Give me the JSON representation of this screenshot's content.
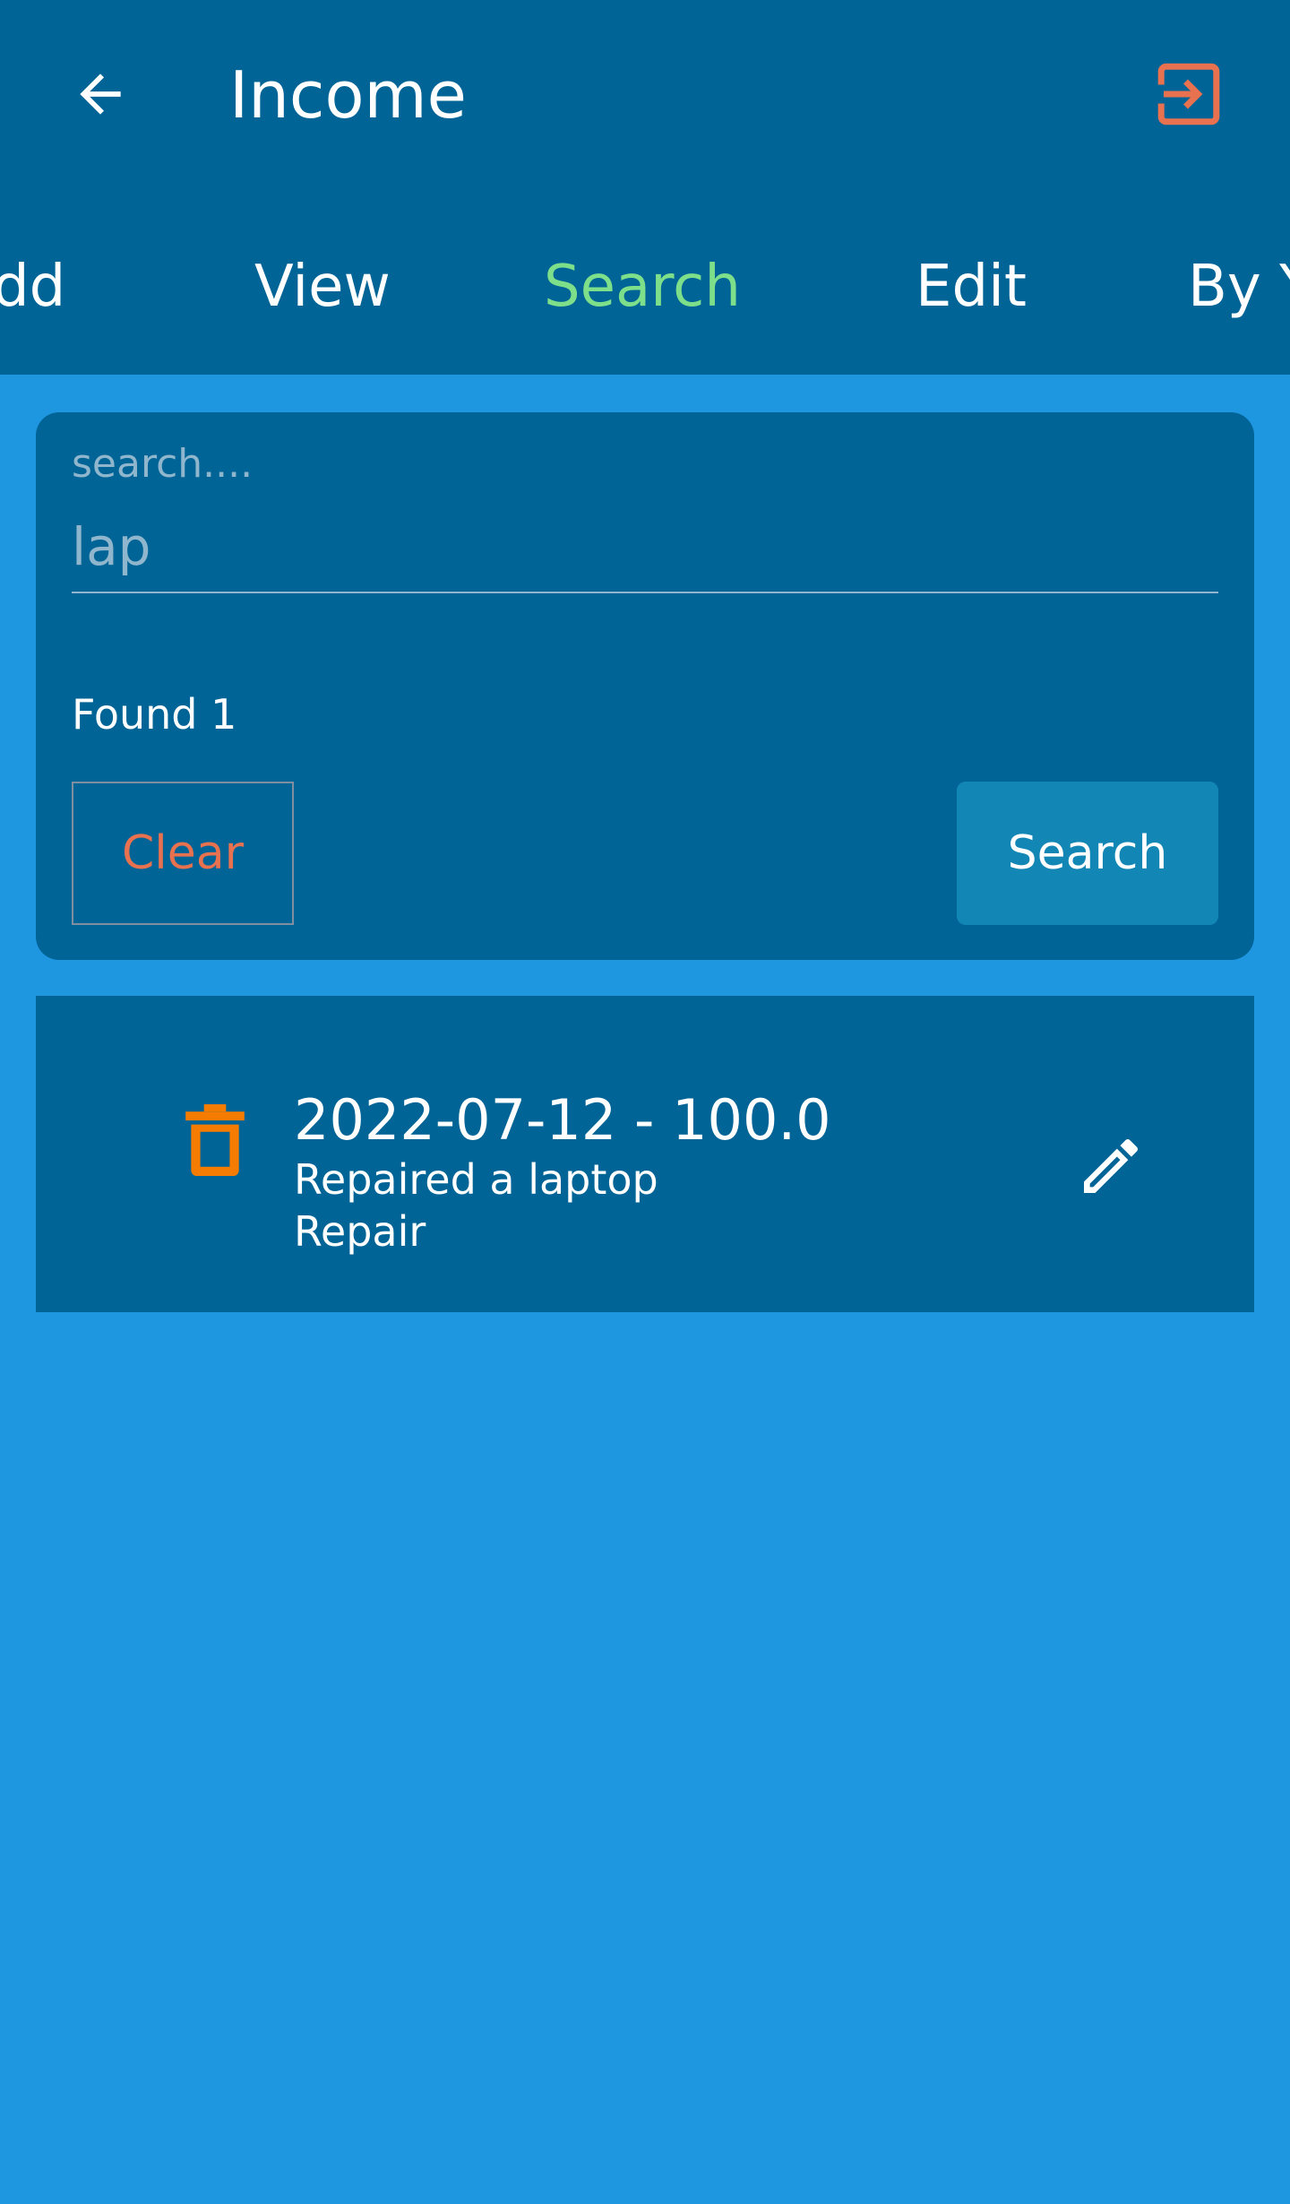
{
  "appbar": {
    "title": "Income",
    "back_icon": "arrow-left-icon",
    "logout_icon": "logout-icon"
  },
  "tabs": [
    {
      "label": "dd",
      "active": false
    },
    {
      "label": "View",
      "active": false
    },
    {
      "label": "Search",
      "active": true
    },
    {
      "label": "Edit",
      "active": false
    },
    {
      "label": "By Y",
      "active": false
    }
  ],
  "search": {
    "label": "search....",
    "value": "lap",
    "found_text": "Found 1",
    "clear_label": "Clear",
    "search_label": "Search"
  },
  "results": [
    {
      "title": "2022-07-12 - 100.0",
      "description": "Repaired a laptop",
      "category": "Repair",
      "delete_icon": "trash-icon",
      "edit_icon": "pencil-icon"
    }
  ],
  "colors": {
    "background": "#1e96e0",
    "appbar": "#006496",
    "active_tab": "#7ddf8a",
    "accent_orange": "#e8714f",
    "delete_orange": "#f57c00",
    "search_button": "#1287b6"
  }
}
